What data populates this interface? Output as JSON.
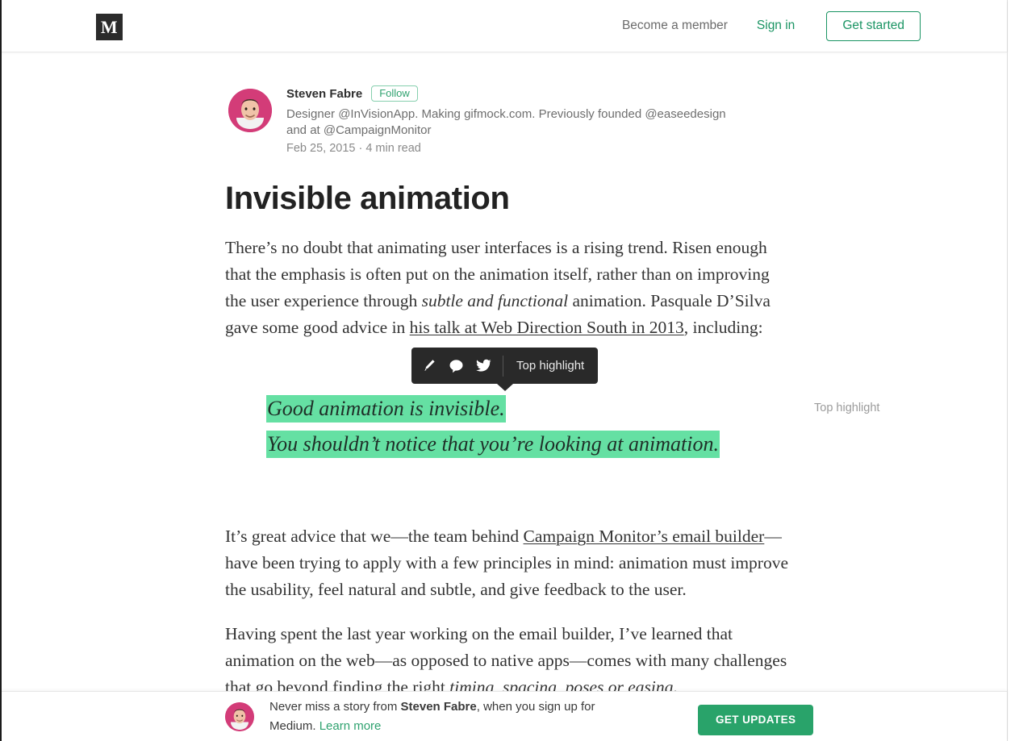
{
  "header": {
    "logo_text": "M",
    "become_member": "Become a member",
    "sign_in": "Sign in",
    "get_started": "Get started",
    "accent_green": "#1a9463"
  },
  "byline": {
    "author": "Steven Fabre",
    "follow_label": "Follow",
    "bio": "Designer @InVisionApp. Making gifmock.com. Previously founded @easeedesign and at @CampaignMonitor",
    "meta": "Feb 25, 2015 · 4 min read",
    "avatar_bg": "#d33c78"
  },
  "article": {
    "title": "Invisible animation",
    "paragraph1": {
      "part1": "There’s no doubt that animating user interfaces is a rising trend. Risen enough that the emphasis is often put on the animation itself, rather than on improving the user experience through ",
      "emphasis": "subtle and functional",
      "part2": " animation. Pasquale D’Silva gave some good advice in ",
      "link": "his talk at Web Direction South in 2013",
      "part3": ", including:"
    },
    "quote_line1": "Good animation is invisible.",
    "quote_line2": "You shouldn’t notice that you’re looking at animation.",
    "quote_highlight_color": "#65e0a3",
    "margin_note": "Top highlight",
    "paragraph2": {
      "part1": "It’s great advice that we—the team behind ",
      "link": "Campaign Monitor’s email builder",
      "part2": "—have been trying to apply with a few principles in mind: animation must improve the usability, feel natural and subtle, and give feedback to the user."
    },
    "paragraph3": {
      "part1": "Having spent the last year working on the email builder, I’ve learned that animation on the web—as opposed to native apps—comes with many challenges that go beyond finding the right ",
      "link": "timing, spacing, poses or easing",
      "part2": "."
    }
  },
  "highlight_toolbar": {
    "label": "Top highlight",
    "icons": [
      "highlighter-icon",
      "comment-icon",
      "twitter-icon"
    ],
    "background": "#292929"
  },
  "signup_bar": {
    "text_before": "Never miss a story from ",
    "author": "Steven Fabre",
    "text_after": ", when you sign up for Medium. ",
    "learn_more": "Learn more",
    "button_label": "GET UPDATES",
    "button_color": "#29a36a"
  }
}
